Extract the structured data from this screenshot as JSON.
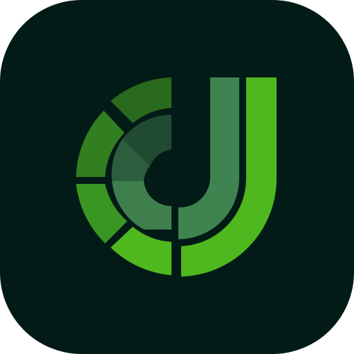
{
  "app_icon": {
    "icon": "app-logo-j-icon",
    "colors": {
      "tile_background": "#031b17",
      "outer_ring_top": "#2a6a1e",
      "outer_ring_upper_left": "#327f22",
      "outer_ring_lower_left": "#3a9622",
      "outer_ring_bottom": "#50b81f",
      "inner_ring_top": "#214a32",
      "inner_ring_left": "#2c5e3e",
      "inner_ring_bottom": "#3f7f4e",
      "j_shadow_stroke": "#3f8450",
      "j_bright_stroke": "#4fb81e"
    }
  }
}
